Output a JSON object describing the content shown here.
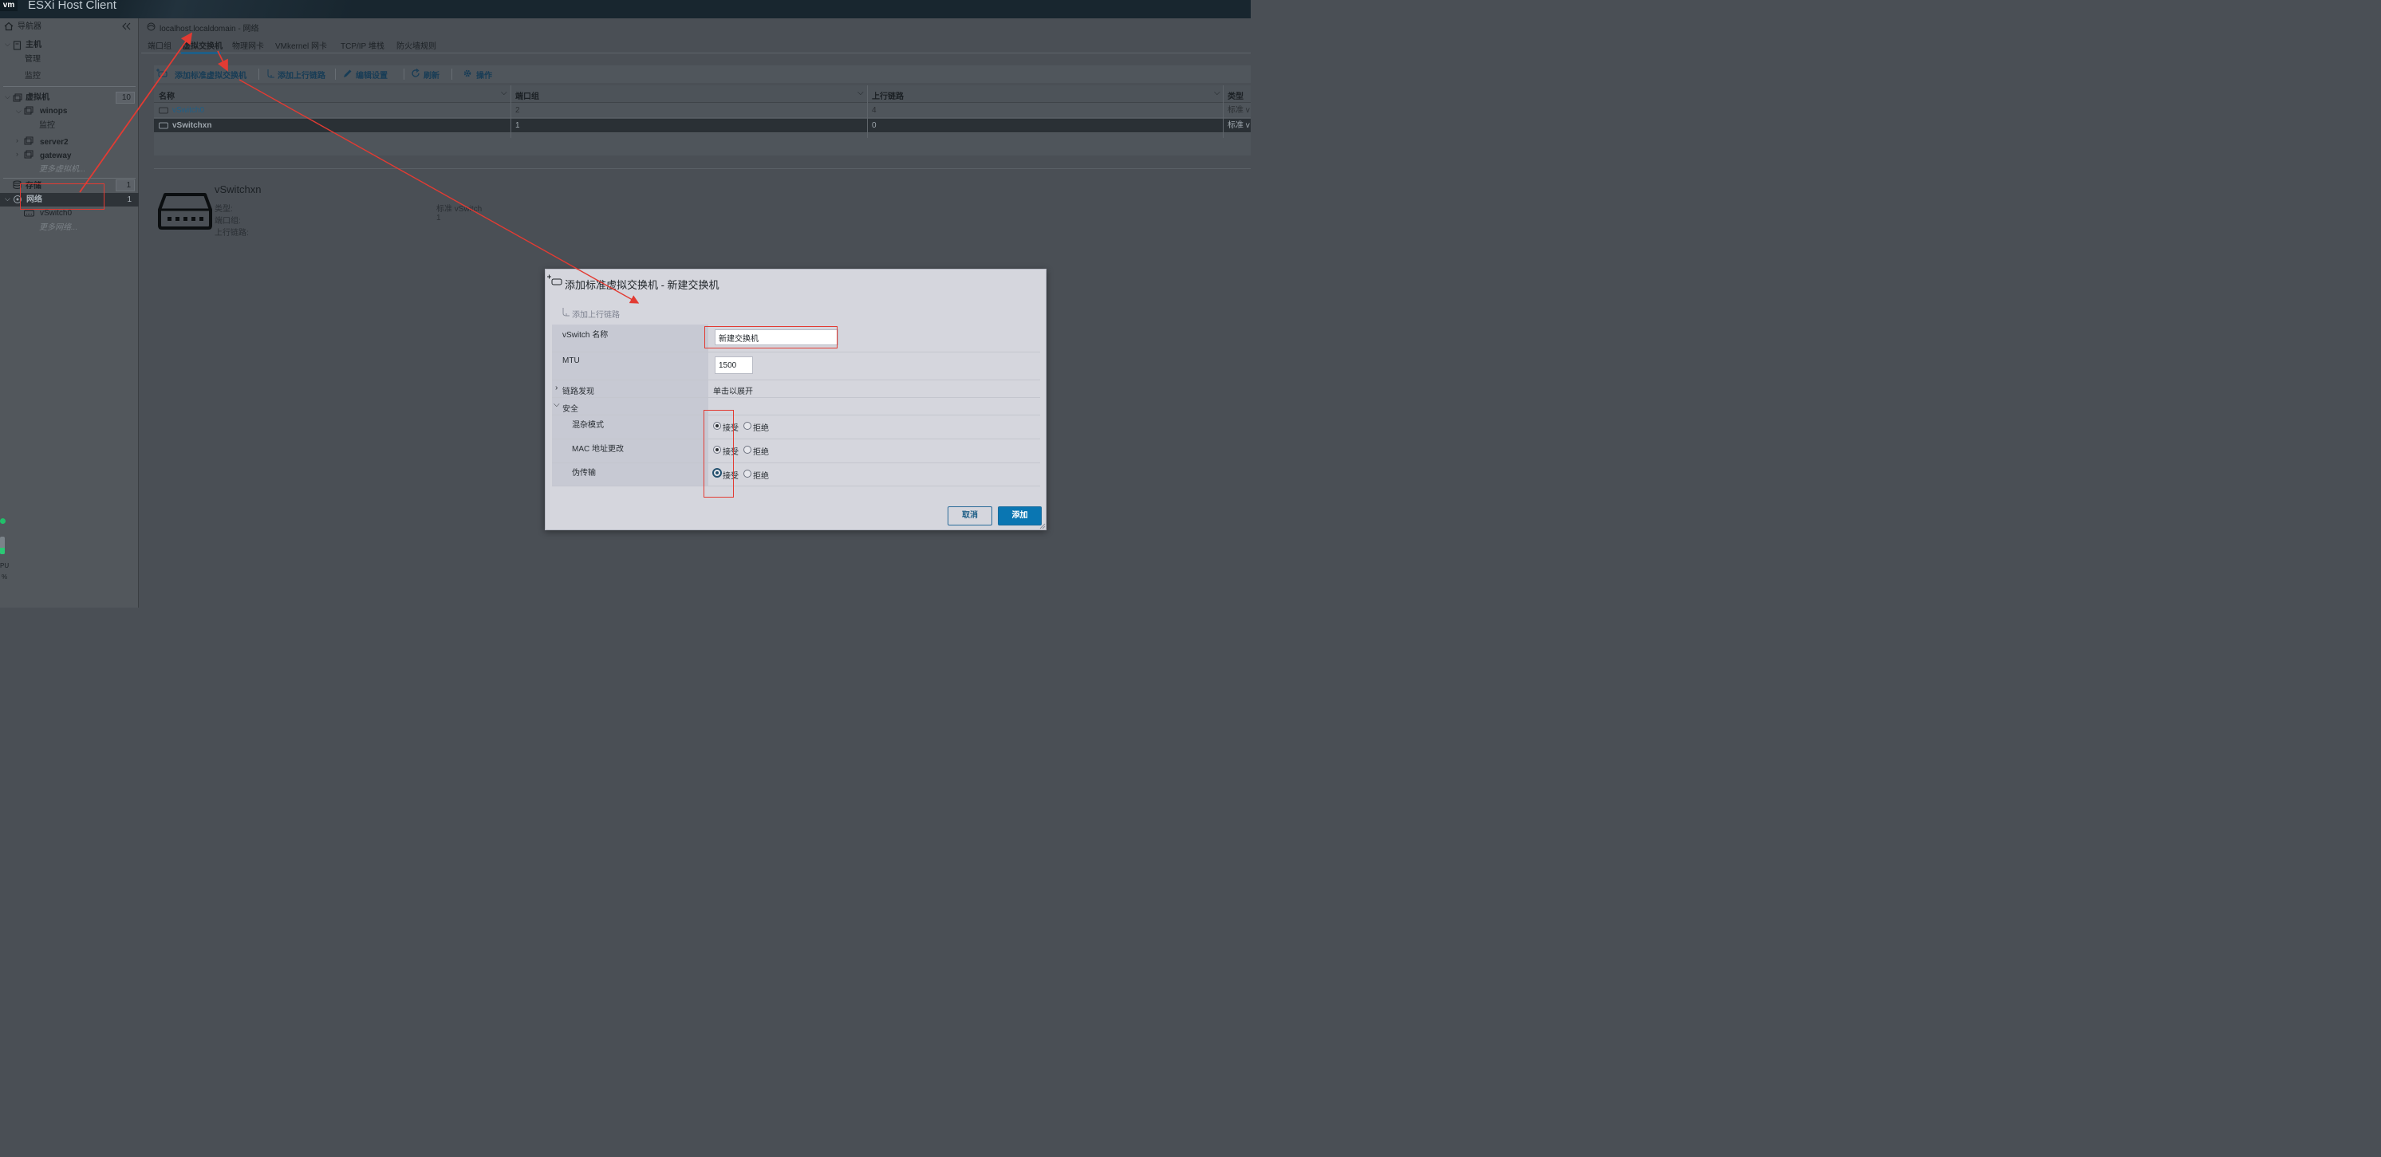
{
  "app": {
    "logo": "vm",
    "title": "ESXi Host Client"
  },
  "navigator": {
    "title": "导航器",
    "host": "主机",
    "host_items": [
      "管理",
      "监控"
    ],
    "vms": "虚拟机",
    "vms_count": "10",
    "vm_list": [
      "winops",
      "server2",
      "gateway"
    ],
    "vm_monitor": "监控",
    "more_vms": "更多虚拟机...",
    "storage": "存储",
    "storage_count": "1",
    "network": "网络",
    "network_count": "1",
    "network_items": [
      "vSwitch0"
    ],
    "more_networks": "更多网络..."
  },
  "breadcrumb": "localhost.localdomain - 网络",
  "tabs": [
    "端口组",
    "虚拟交换机",
    "物理网卡",
    "VMkernel 网卡",
    "TCP/IP 堆栈",
    "防火墙规则"
  ],
  "toolbar": {
    "add_switch": "添加标准虚拟交换机",
    "add_uplink": "添加上行链路",
    "edit": "编辑设置",
    "refresh": "刷新",
    "actions": "操作"
  },
  "table": {
    "columns": [
      "名称",
      "端口组",
      "上行链路",
      "类型"
    ],
    "rows": [
      [
        "vSwitch0",
        "2",
        "4",
        "标准 v"
      ],
      [
        "vSwitchxn",
        "1",
        "0",
        "标准 v"
      ]
    ]
  },
  "detail": {
    "name": "vSwitchxn",
    "labels": [
      "类型:",
      "端口组:",
      "上行链路:"
    ],
    "values": [
      "标准 vSwitch",
      "1",
      ""
    ]
  },
  "modal": {
    "title": "添加标准虚拟交换机 - 新建交换机",
    "add_uplink": "添加上行链路",
    "name_label": "vSwitch 名称",
    "name_value": "新建交换机",
    "mtu_label": "MTU",
    "mtu_value": "1500",
    "link_label": "链路发现",
    "link_value": "单击以展开",
    "security_label": "安全",
    "promisc_label": "混杂模式",
    "mac_label": "MAC 地址更改",
    "forged_label": "伪传输",
    "accept": "接受",
    "reject": "拒绝",
    "cancel": "取消",
    "add": "添加"
  },
  "side_indicator": {
    "label": "PU",
    "value": "%"
  }
}
